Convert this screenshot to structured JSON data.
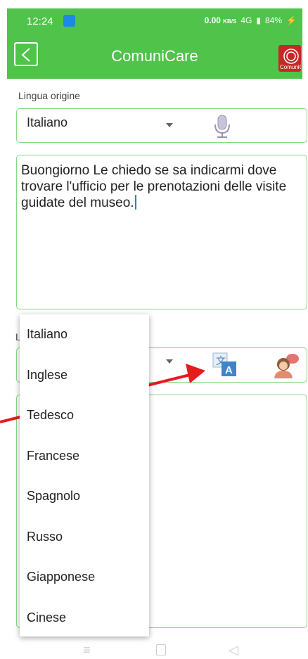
{
  "status": {
    "time": "12:24",
    "speed": "0.00",
    "speed_unit": "KB/S",
    "network": "4G",
    "battery": "84%"
  },
  "header": {
    "title": "ComuniCare",
    "logo_text": "ComuniCare"
  },
  "source": {
    "label": "Lingua origine",
    "selected": "Italiano",
    "text": "Buongiorno Le chiedo se sa indicarmi dove trovare l'ufficio per le prenotazioni delle visite guidate del museo."
  },
  "target": {
    "label_initial": "L"
  },
  "dropdown": {
    "options": [
      "Italiano",
      "Inglese",
      "Tedesco",
      "Francese",
      "Spagnolo",
      "Russo",
      "Giapponese",
      "Cinese"
    ]
  },
  "icons": {
    "back": "back-icon",
    "mic": "microphone-icon",
    "translate": "translate-icon",
    "speak": "speaker-avatar-icon"
  },
  "colors": {
    "brand": "#4fc34a",
    "border": "#86d782",
    "arrow": "#e51c1c"
  }
}
